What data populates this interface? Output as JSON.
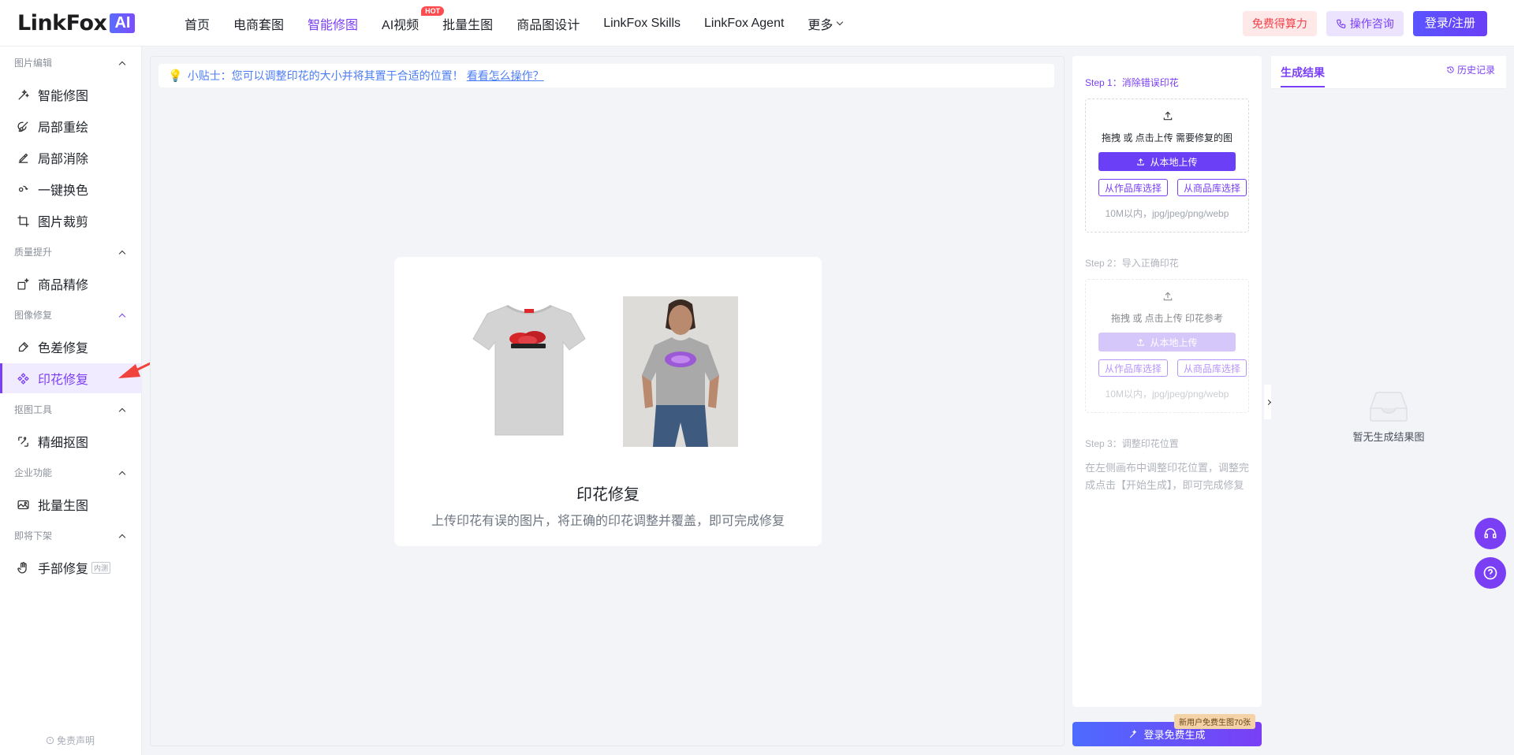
{
  "brand": {
    "name": "LinkFox",
    "badge": "AI"
  },
  "nav": {
    "items": [
      {
        "label": "首页",
        "active": false
      },
      {
        "label": "电商套图",
        "active": false
      },
      {
        "label": "智能修图",
        "active": true
      },
      {
        "label": "AI视频",
        "active": false,
        "badge": "HOT"
      },
      {
        "label": "批量生图",
        "active": false
      },
      {
        "label": "商品图设计",
        "active": false
      },
      {
        "label": "LinkFox Skills",
        "active": false
      },
      {
        "label": "LinkFox Agent",
        "active": false
      }
    ],
    "more_label": "更多"
  },
  "header_actions": {
    "free_label": "免费得算力",
    "consult_label": "操作咨询",
    "login_label": "登录/注册"
  },
  "sidebar": {
    "groups": [
      {
        "title": "图片编辑",
        "items": [
          "智能修图",
          "局部重绘",
          "局部消除",
          "一键换色",
          "图片裁剪"
        ]
      },
      {
        "title": "质量提升",
        "items": [
          "商品精修"
        ]
      },
      {
        "title": "图像修复",
        "items": [
          "色差修复",
          "印花修复"
        ]
      },
      {
        "title": "抠图工具",
        "items": [
          "精细抠图"
        ]
      },
      {
        "title": "企业功能",
        "items": [
          "批量生图"
        ]
      },
      {
        "title": "即将下架",
        "items": [
          "手部修复"
        ]
      }
    ],
    "active_item": "印花修复",
    "beta_badge": "内测",
    "disclaimer": "免责声明"
  },
  "canvas": {
    "tip_prefix": "小贴士：您可以调整印花的大小并将其置于合适的位置！",
    "tip_link": "看看怎么操作？",
    "sample_title": "印花修复",
    "sample_subtitle": "上传印花有误的图片，将正确的印花调整并覆盖，即可完成修复"
  },
  "steps": {
    "step1": {
      "label": "Step 1：消除错误印花",
      "upload_text": "拖拽 或 点击上传 需要修复的图",
      "upload_btn": "从本地上传",
      "pick_works": "从作品库选择",
      "pick_products": "从商品库选择",
      "hint": "10M以内，jpg/jpeg/png/webp"
    },
    "step2": {
      "label": "Step 2：导入正确印花",
      "upload_text": "拖拽 或 点击上传 印花参考",
      "upload_btn": "从本地上传",
      "pick_works": "从作品库选择",
      "pick_products": "从商品库选择",
      "hint": "10M以内，jpg/jpeg/png/webp"
    },
    "step3": {
      "label": "Step 3：调整印花位置",
      "desc": "在左侧画布中调整印花位置，调整完成点击【开始生成】，即可完成修复"
    },
    "generate_label": "登录免费生成",
    "new_user_badge": "新用户免费生图70张"
  },
  "results": {
    "tab_label": "生成结果",
    "history_label": "历史记录",
    "empty_text": "暂无生成结果图"
  },
  "colors": {
    "accent": "#7a3ff5",
    "tip_blue": "#4c7df5",
    "arrow_red": "#f0433d"
  }
}
